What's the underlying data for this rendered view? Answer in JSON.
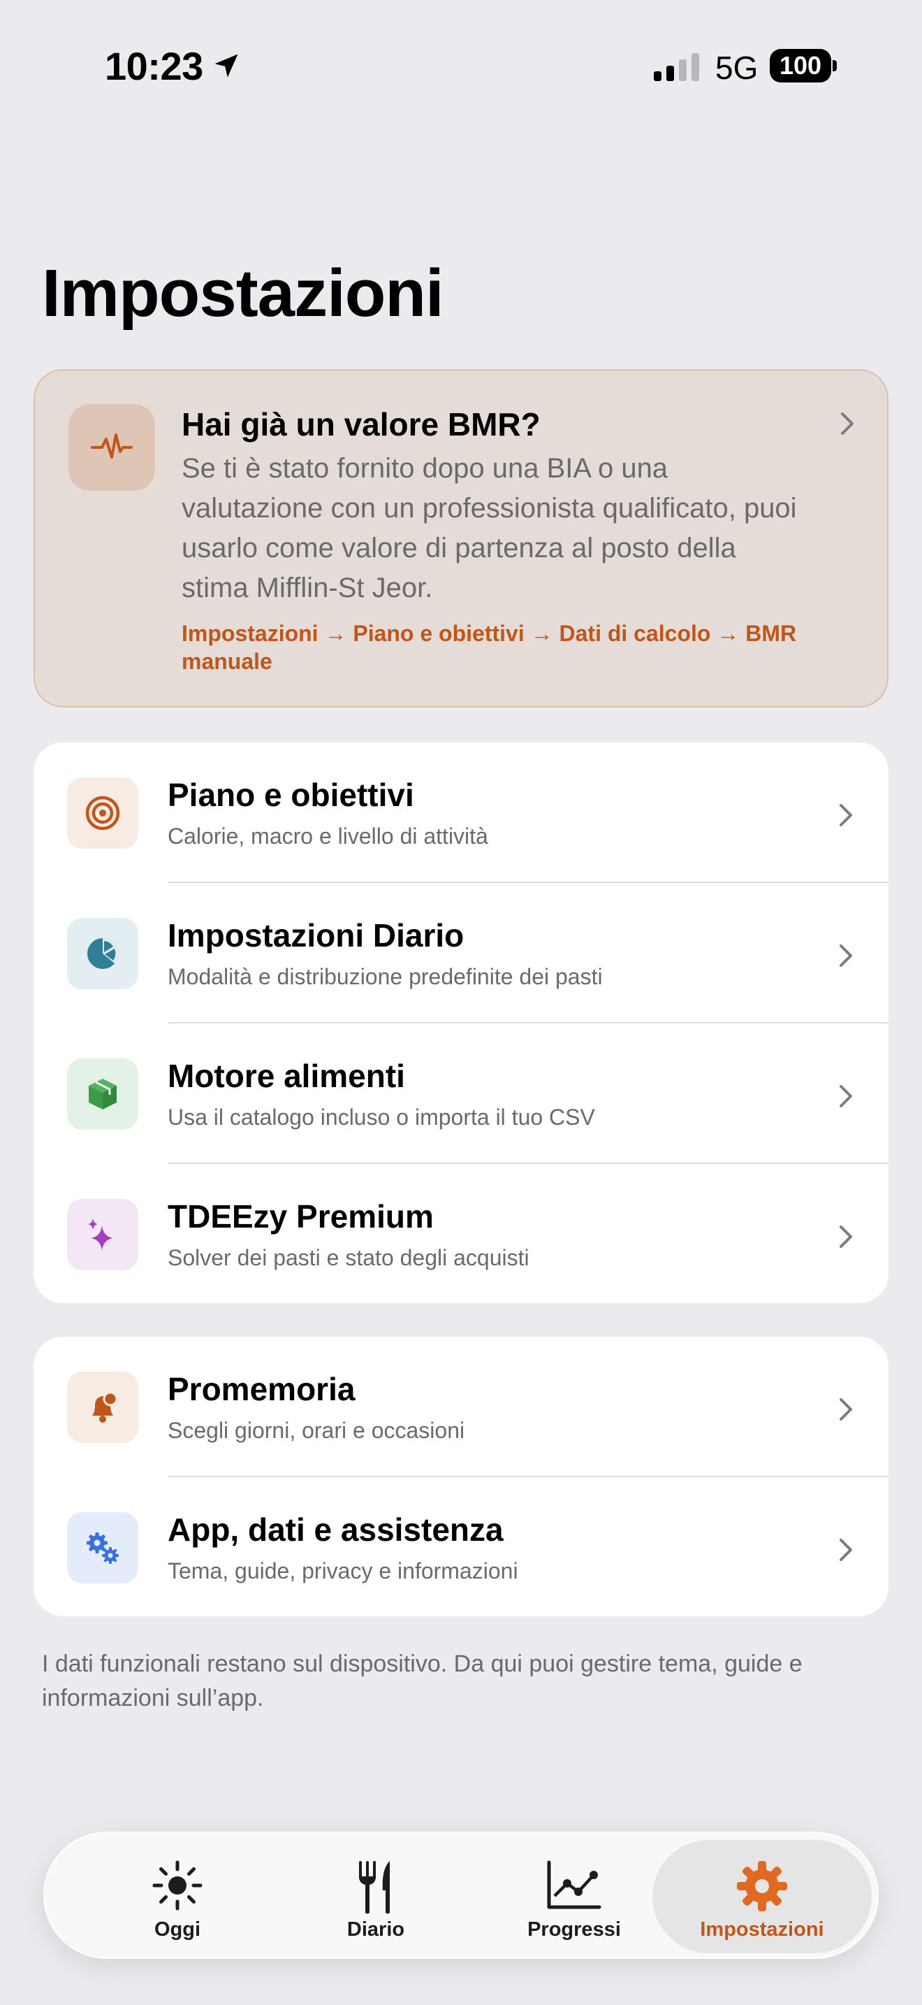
{
  "status_bar": {
    "time": "10:23",
    "network": "5G",
    "battery": "100"
  },
  "page": {
    "title": "Impostazioni"
  },
  "bmr_card": {
    "icon": "waveform-icon",
    "title": "Hai già un valore BMR?",
    "body": "Se ti è stato fornito dopo una BIA o una valutazione con un professionista qualificato, puoi usarlo come valore di partenza al posto della stima Mifflin-St Jeor.",
    "path": "Impostazioni → Piano e obiettivi → Dati di calcolo → BMR manuale"
  },
  "groups": [
    {
      "items": [
        {
          "icon": "target-icon",
          "title": "Piano e obiettivi",
          "subtitle": "Calorie, macro e livello di attività",
          "icon_bg": "#f7ebe3",
          "icon_color": "#c0561a"
        },
        {
          "icon": "pie-chart-icon",
          "title": "Impostazioni Diario",
          "subtitle": "Modalità e distribuzione predefinite dei pasti",
          "icon_bg": "#e2eef2",
          "icon_color": "#2f7f96"
        },
        {
          "icon": "box-icon",
          "title": "Motore alimenti",
          "subtitle": "Usa il catalogo incluso o importa il tuo CSV",
          "icon_bg": "#e4f1e6",
          "icon_color": "#3c9a4a"
        },
        {
          "icon": "sparkles-icon",
          "title": "TDEEzy Premium",
          "subtitle": "Solver dei pasti e stato degli acquisti",
          "icon_bg": "#f3e6f5",
          "icon_color": "#a23fc0"
        }
      ]
    },
    {
      "items": [
        {
          "icon": "bell-icon",
          "title": "Promemoria",
          "subtitle": "Scegli giorni, orari e occasioni",
          "icon_bg": "#f7ebe3",
          "icon_color": "#c0561a"
        },
        {
          "icon": "gears-icon",
          "title": "App, dati e assistenza",
          "subtitle": "Tema, guide, privacy e informazioni",
          "icon_bg": "#e4ecfa",
          "icon_color": "#3a6fe0"
        }
      ]
    }
  ],
  "footnote": "I dati funzionali restano sul dispositivo. Da qui puoi gestire tema, guide e informazioni sull’app.",
  "tab_bar": {
    "tabs": [
      {
        "label": "Oggi",
        "icon": "sun-icon"
      },
      {
        "label": "Diario",
        "icon": "fork-knife-icon"
      },
      {
        "label": "Progressi",
        "icon": "line-chart-icon"
      },
      {
        "label": "Impostazioni",
        "icon": "gear-icon",
        "active": true
      }
    ]
  },
  "colors": {
    "accent": "#c0561a",
    "background": "#ebebef"
  }
}
